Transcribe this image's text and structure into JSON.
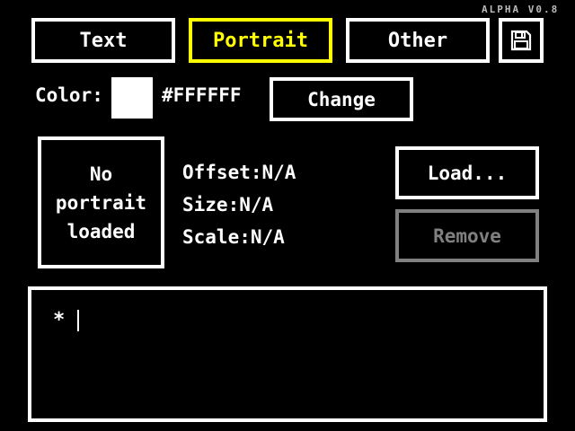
{
  "version": "ALPHA V0.8",
  "tabs": [
    {
      "label": "Text"
    },
    {
      "label": "Portrait"
    },
    {
      "label": "Other"
    }
  ],
  "active_tab": "Portrait",
  "save_icon": "floppy-disk-icon",
  "color": {
    "label": "Color:",
    "swatch": "#FFFFFF",
    "hex": "#FFFFFF",
    "change_label": "Change"
  },
  "portrait": {
    "line1": "No",
    "line2": "portrait",
    "line3": "loaded",
    "offset_label": "Offset:",
    "offset_value": "N/A",
    "size_label": "Size:",
    "size_value": "N/A",
    "scale_label": "Scale:",
    "scale_value": "N/A",
    "load_label": "Load...",
    "remove_label": "Remove"
  },
  "dialog": {
    "prompt": "*",
    "text": ""
  },
  "colors": {
    "accent": "#FFFF00",
    "disabled": "#808080",
    "background": "#000000",
    "foreground": "#FFFFFF"
  }
}
